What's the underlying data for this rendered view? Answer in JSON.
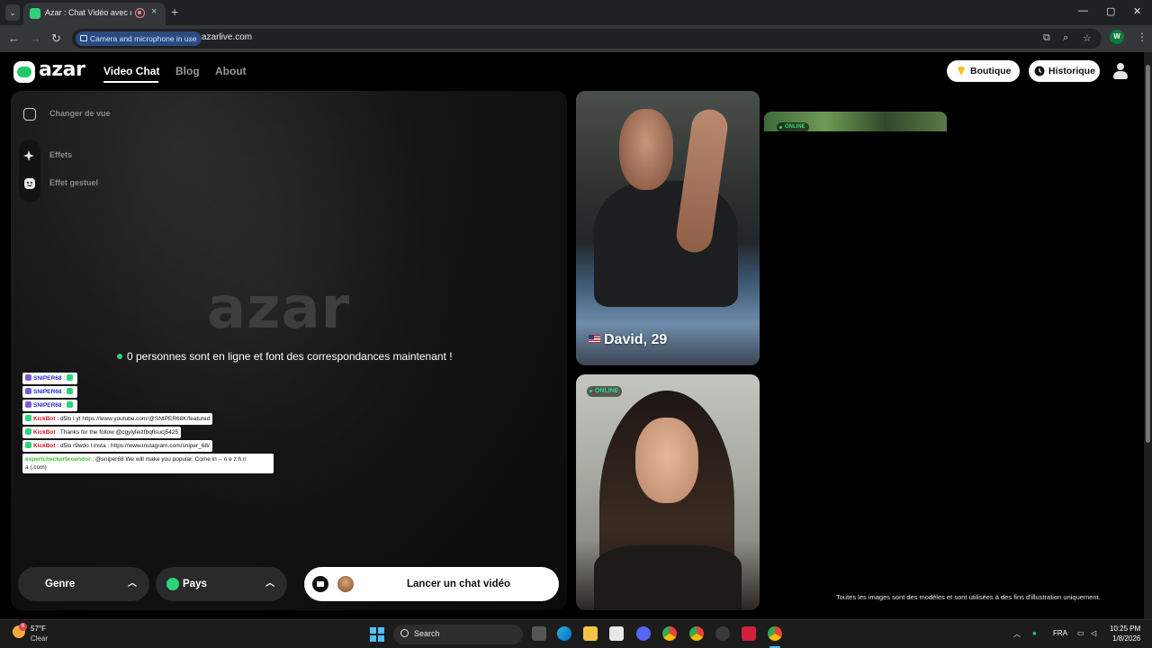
{
  "browser": {
    "tab_title": "Azar : Chat Vidéo avec de n",
    "tab_close": "×",
    "new_tab": "+",
    "permission_chip": "Camera and microphone in use",
    "url": "azarlive.com",
    "profile_initial": "W",
    "window_controls": {
      "minimize": "—",
      "maximize": "▢",
      "close": "✕"
    },
    "nav": {
      "back": "←",
      "forward": "→",
      "reload": "↻"
    }
  },
  "header": {
    "logo_text": "azar",
    "nav": {
      "video_chat": "Video Chat",
      "blog": "Blog",
      "about": "About"
    },
    "boutique": "Boutique",
    "historique": "Historique"
  },
  "sidebar": {
    "changer_de_vue": "Changer de vue",
    "effets": "Effets",
    "effet_gestuel": "Effet gestuel"
  },
  "main": {
    "watermark": "azar",
    "online_text": "0 personnes sont en ligne et font des correspondances maintenant !"
  },
  "chat": [
    {
      "user": "SNIPER68",
      "text": ":"
    },
    {
      "user": "SNIPER68",
      "text": ":"
    },
    {
      "user": "SNIPER68",
      "text": ":"
    },
    {
      "user": "KickBot",
      "text": ": d5lo l yt https://www.youtube.com/@SNIPER68K/featured"
    },
    {
      "user": "KickBot",
      "text": ": Thanks for the follow @cgylyleizfbqfisucj5425"
    },
    {
      "user": "KickBot",
      "text": ": d5lo r9wdo l insta : https://www.instagram.com/sniper_68/"
    },
    {
      "user": "expertcheckerbroendor",
      "text": ": @sniper68 We will make you popular. Come in -- n e z h n",
      "text2": "a (.com)"
    }
  ],
  "controls": {
    "genre": "Genre",
    "pays": "Pays",
    "start": "Lancer un chat vidéo"
  },
  "cards": {
    "man_name": "David, 29",
    "online_label": "ONLINE",
    "online_label_2": "ONLINE"
  },
  "disclaimer": "Toutes les images sont des modèles et sont utilisées à des fins d'illustration uniquement.",
  "taskbar": {
    "temperature": "57°F",
    "condition": "Clear",
    "weather_badge": "6",
    "search": "Search",
    "language": "FRA",
    "time": "10:25 PM",
    "date": "1/8/2026"
  },
  "colors": {
    "accent": "#2ed47a",
    "brand": "#20c967"
  }
}
